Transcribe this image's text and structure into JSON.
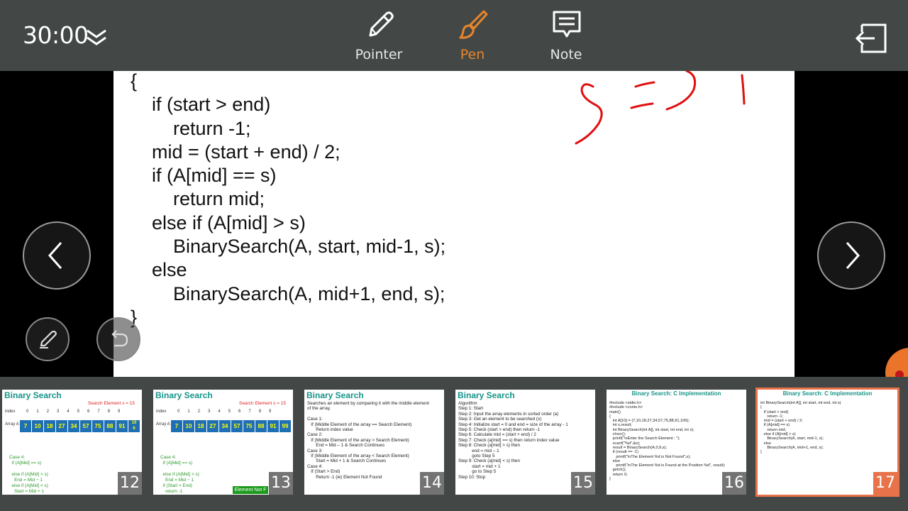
{
  "toolbar": {
    "timer": "30:00",
    "tools": [
      {
        "id": "pointer",
        "label": "Pointer",
        "icon": "pencil-icon",
        "active": false
      },
      {
        "id": "pen",
        "label": "Pen",
        "icon": "pen-brush-icon",
        "active": true
      },
      {
        "id": "note",
        "label": "Note",
        "icon": "note-icon",
        "active": false
      }
    ],
    "accent_color": "#e8852a"
  },
  "slide": {
    "code_lines": [
      "{",
      "    if (start > end)",
      "        return -1;",
      "    mid = (start + end) / 2;",
      "    if (A[mid] == s)",
      "        return mid;",
      "    else if (A[mid] > s)",
      "        BinarySearch(A, start, mid-1, s);",
      "    else",
      "        BinarySearch(A, mid+1, end, s);",
      "}"
    ],
    "ink_color": "#e01010"
  },
  "thumbnails": [
    {
      "number": "12",
      "title": "Binary Search",
      "search_element": "Search Element s = 15",
      "index_label": "index",
      "indices": [
        "0",
        "1",
        "2",
        "3",
        "4",
        "5",
        "6",
        "7",
        "8",
        "9"
      ],
      "array_label": "Array A",
      "array": [
        "7",
        "10",
        "18",
        "27",
        "34",
        "57",
        "75",
        "88",
        "91",
        "10\n6"
      ],
      "case_text": "Case 4:\n  if (A[Mid] == s)\n\n  else if (A[Mid] > s)\n    End = Mid − 1\n  else if (A[Mid] < s)\n    Start = Mid + 1"
    },
    {
      "number": "13",
      "title": "Binary Search",
      "search_element": "Search Element s = 15",
      "index_label": "index",
      "indices": [
        "0",
        "1",
        "2",
        "3",
        "4",
        "5",
        "6",
        "7",
        "8",
        "9"
      ],
      "array_label": "Array A",
      "array": [
        "7",
        "10",
        "18",
        "27",
        "34",
        "57",
        "75",
        "88",
        "91",
        "99"
      ],
      "case_text": "Case 4:\n  if (A[Mid] == s)\n\n  else if (A[Mid] > s)\n    End = Mid − 1\n  if (Start > End)\n    return -1",
      "not_found": "Element Not F"
    },
    {
      "number": "14",
      "title": "Binary Search",
      "body": "Searches an element by comparing it with the middle element\nof the array.\n\nCase 1:\n   If (Middle Element of the array == Search Element)\n       Return index value\nCase 2:\n   If (Middle Element of the array > Search Element)\n       End = Mid – 1 & Search Continues\nCase 3:\n   If (Middle Element of the array < Search Element)\n       Start = Mid + 1 & Search Continues\nCase 4:\n   If (Start > End)\n       Return -1 (ie) Element Not Found"
    },
    {
      "number": "15",
      "title": "Binary Search",
      "body": "Algorithm\nStep 1: Start\nStep 2: Input the array elements in sorted order (a)\nStep 3: Get an element to be searched (s)\nStep 4: Initialize start = 0 and end = size of the array - 1\nStep 5: Check (start > end) then return -1\nStep 6: Calculate mid = (start + end) / 2\nStep 7: Check (a[mid] == s) then return index value\nStep 8: Check (a[mid] > s) then\n           end = mid – 1\n           goto Step 5\nStep 9: Check (a[mid] < s) then\n           start = mid + 1\n           go to Step 5\nStep 10: Stop"
    },
    {
      "number": "16",
      "title": "Binary Search: C Implementation",
      "body": "#include <stdio.h>\n#include <conio.h>\nmain()\n{\n   int A[10] = {7,10,18,27,34,57,75,88,91,106};\n   int s,result;\n   int BinarySearch(int A[], int start, int end, int s);\n   clrscr();\n   printf(\"\\nEnter the Search Element : \");\n   scanf(\"%d\",&s);\n   result = BinarySearch(A,0,9,s);\n   if (result == -1)\n      printf(\"\\nThe Element %d is Not Found\",s);\n   else\n      printf(\"\\nThe Element %d is Found at the Position %d\", result);\n   getch();\n   return 0;\n}"
    },
    {
      "number": "17",
      "title": "Binary Search: C Implementation",
      "body": "int BinarySearch(int A[], int start, int end, int s)\n{\n   if (start > end)\n      return -1;\n   mid = (start + end) / 2;\n   if (A[mid] == s)\n      return mid;\n   else if (A[mid] > s)\n      BinarySearch(A, start, mid-1, s);\n   else\n      BinarySearch(A, mid+1, end, s);\n}",
      "active": true
    }
  ]
}
